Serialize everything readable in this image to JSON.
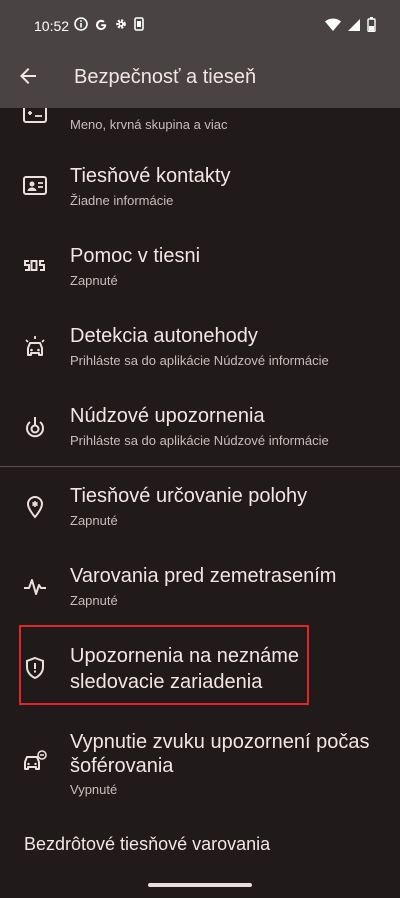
{
  "status_bar": {
    "time": "10:52"
  },
  "app_bar": {
    "title": "Bezpečnosť a tieseň"
  },
  "items": [
    {
      "title": "",
      "summary": "Meno, krvná skupina a viac",
      "icon": "medical-card-icon"
    },
    {
      "title": "Tiesňové kontakty",
      "summary": "Žiadne informácie",
      "icon": "contact-card-icon"
    },
    {
      "title": "Pomoc v tiesni",
      "summary": "Zapnuté",
      "icon": "sos-icon"
    },
    {
      "title": "Detekcia autonehody",
      "summary": "Prihláste sa do aplikácie Núdzové informácie",
      "icon": "car-crash-icon"
    },
    {
      "title": "Núdzové upozornenia",
      "summary": "Prihláste sa do aplikácie Núdzové informácie",
      "icon": "emergency-alert-icon"
    },
    {
      "title": "Tiesňové určovanie polohy",
      "summary": "Zapnuté",
      "icon": "location-icon"
    },
    {
      "title": "Varovania pred zemetrasením",
      "summary": "Zapnuté",
      "icon": "earthquake-icon"
    },
    {
      "title_line1": "Upozornenia na neznáme",
      "title_line2": "sledovacie zariadenia",
      "icon": "shield-icon"
    },
    {
      "title_line1": "Vypnutie zvuku upozornení počas",
      "title_line2": "šoférovania",
      "summary": "Vypnuté",
      "icon": "driving-mute-icon"
    }
  ],
  "wireless_alerts": {
    "title": "Bezdrôtové tiesňové varovania"
  }
}
